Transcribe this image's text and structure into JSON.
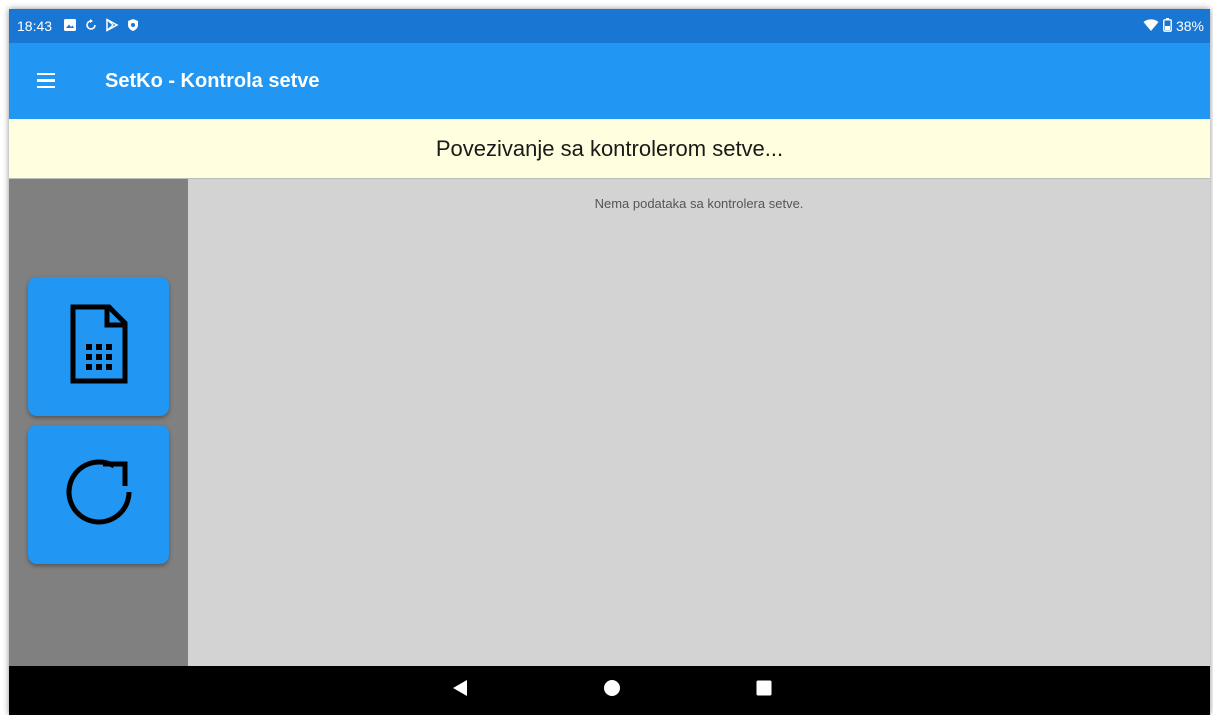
{
  "status_bar": {
    "time": "18:43",
    "battery_percent": "38%",
    "left_icons": [
      "image-icon",
      "sync-icon",
      "play-store-icon",
      "shield-icon"
    ],
    "right_icons": [
      "wifi-icon",
      "battery-icon"
    ]
  },
  "app_bar": {
    "title": "SetKo - Kontrola setve",
    "menu_icon": "menu-icon"
  },
  "banner": {
    "text": "Povezivanje sa kontrolerom setve..."
  },
  "sidebar": {
    "buttons": [
      {
        "icon": "spreadsheet-document-icon"
      },
      {
        "icon": "refresh-icon"
      }
    ]
  },
  "content": {
    "empty_message": "Nema podataka sa kontrolera setve."
  },
  "nav_bar": {
    "buttons": [
      "back-icon",
      "home-icon",
      "recents-icon"
    ]
  },
  "colors": {
    "status_bar": "#1976d2",
    "app_bar": "#2196f3",
    "banner": "#fffede",
    "sidebar": "#808080",
    "content": "#d3d3d3",
    "side_button": "#2196f3",
    "nav_bar": "#000000"
  }
}
